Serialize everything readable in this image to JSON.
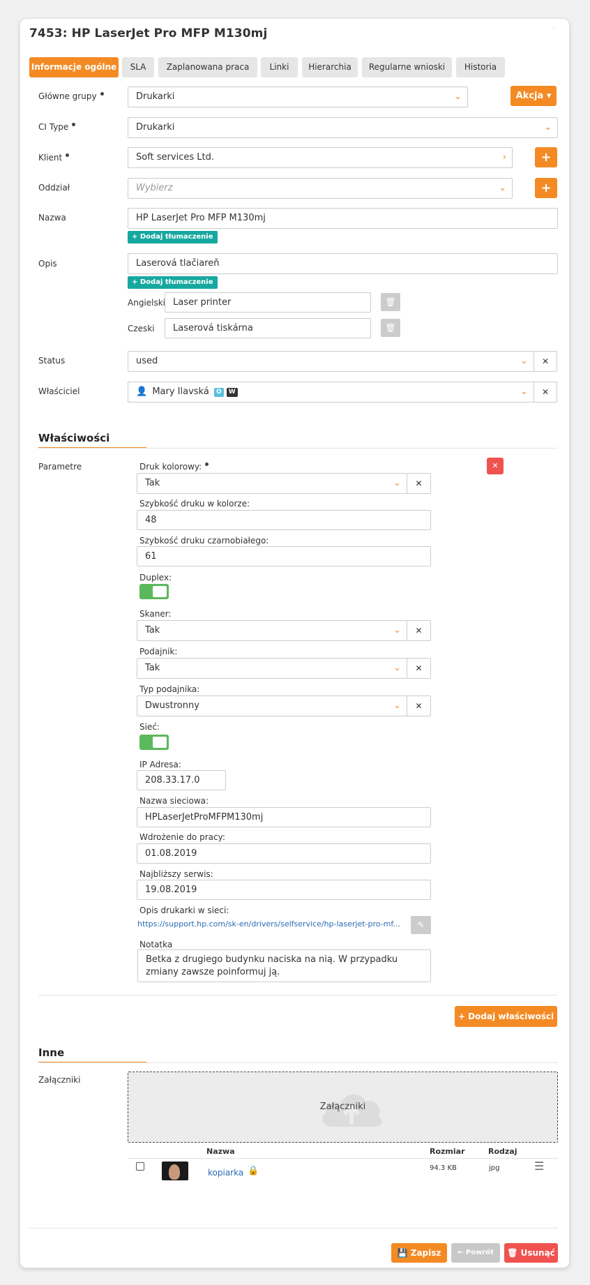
{
  "window": {
    "title": "7453: HP LaserJet Pro MFP M130mj",
    "close": "·"
  },
  "tabs": [
    "Informacje ogólne",
    "SLA",
    "Zaplanowana praca",
    "Linki",
    "Hierarchia",
    "Regularne wnioski",
    "Historia"
  ],
  "form": {
    "main_groups": {
      "label": "Główne grupy",
      "value": "Drukarki"
    },
    "action_button": "Akcja",
    "ci_type": {
      "label": "CI Type",
      "value": "Drukarki"
    },
    "client": {
      "label": "Klient",
      "value": "Soft services Ltd."
    },
    "branch": {
      "label": "Oddział",
      "placeholder": "Wybierz"
    },
    "name": {
      "label": "Nazwa",
      "value": "HP LaserJet Pro MFP M130mj",
      "add_translation": "Dodaj tłumaczenie"
    },
    "description": {
      "label": "Opis",
      "value": "Laserová tlačiareň",
      "add_translation": "Dodaj tłumaczenie",
      "translations": [
        {
          "lang": "Angielski",
          "value": "Laser printer"
        },
        {
          "lang": "Czeski",
          "value": "Laserová tiskárna"
        }
      ]
    },
    "status": {
      "label": "Status",
      "value": "used"
    },
    "owner": {
      "label": "Właściciel",
      "value": "Mary Ilavská",
      "badge1": "O",
      "badge2": "W"
    }
  },
  "properties": {
    "heading": "Właściwości",
    "label": "Parametre",
    "color_print": {
      "label": "Druk kolorowy:",
      "value": "Tak"
    },
    "color_speed": {
      "label": "Szybkość druku w kolorze:",
      "value": "48"
    },
    "bw_speed": {
      "label": "Szybkość druku czarnobiałego:",
      "value": "61"
    },
    "duplex": {
      "label": "Duplex:",
      "on": true
    },
    "scanner": {
      "label": "Skaner:",
      "value": "Tak"
    },
    "feeder": {
      "label": "Podajnik:",
      "value": "Tak"
    },
    "feeder_type": {
      "label": "Typ podajnika:",
      "value": "Dwustronny"
    },
    "network": {
      "label": "Sieć:",
      "on": true
    },
    "ip": {
      "label": "IP Adresa:",
      "value": "208.33.17.0"
    },
    "net_name": {
      "label": "Nazwa sieciowa:",
      "value": "HPLaserJetProMFPM130mj"
    },
    "deploy": {
      "label": "Wdrożenie do pracy:",
      "value": "01.08.2019"
    },
    "next_service": {
      "label": "Najbliższy serwis:",
      "value": "19.08.2019"
    },
    "desc_link": {
      "label": "Opis drukarki w sieci:",
      "value": "https://support.hp.com/sk-en/drivers/selfservice/hp-laserjet-pro-mf..."
    },
    "note": {
      "label": "Notatka",
      "value": "Betka z drugiego budynku naciska na nią. W przypadku zmiany zawsze poinformuj ją."
    },
    "add_button": "Dodaj właściwości"
  },
  "other": {
    "heading": "Inne",
    "attachments_label": "Załączniki",
    "drop_text": "Załączniki",
    "columns": {
      "name": "Nazwa",
      "size": "Rozmiar",
      "type": "Rodzaj"
    },
    "files": [
      {
        "name": "kopiarka",
        "size": "94.3 KB",
        "type": "jpg"
      }
    ]
  },
  "footer": {
    "save": "Zapisz",
    "back": "Powrót",
    "delete": "Usunąć"
  },
  "colors": {
    "accent": "#f48a24",
    "teal": "#16a8a0",
    "danger": "#f0534f",
    "toggle_on": "#5cb85c"
  }
}
